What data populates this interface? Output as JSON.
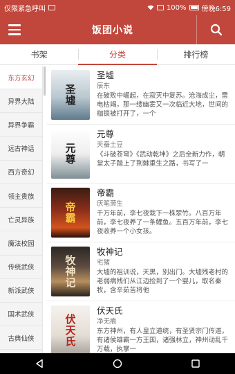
{
  "status_bar": {
    "left_text": "仅限紧急呼叫",
    "battery": "100%",
    "time": "傍晚6:59"
  },
  "app_bar": {
    "title": "饭团小说"
  },
  "tabs": [
    {
      "label": "书架",
      "active": false
    },
    {
      "label": "分类",
      "active": true
    },
    {
      "label": "排行榜",
      "active": false
    }
  ],
  "sidebar": {
    "items": [
      {
        "label": "东方玄幻",
        "active": true
      },
      {
        "label": "异界大陆",
        "active": false
      },
      {
        "label": "异界争霸",
        "active": false
      },
      {
        "label": "远古神话",
        "active": false
      },
      {
        "label": "西方奇幻",
        "active": false
      },
      {
        "label": "领主贵族",
        "active": false
      },
      {
        "label": "亡灵异族",
        "active": false
      },
      {
        "label": "魔法校园",
        "active": false
      },
      {
        "label": "传统武侠",
        "active": false
      },
      {
        "label": "新派武侠",
        "active": false
      },
      {
        "label": "国术武侠",
        "active": false
      },
      {
        "label": "古典仙侠",
        "active": false
      }
    ]
  },
  "books": [
    {
      "title": "圣墟",
      "author": "辰东",
      "desc": "在破败中崛起，在寂灭中复苏。沧海成尘，雷电枯竭，那一缕幽雾又一次临近大地，世间的枷锁被打开了，一个",
      "cover_text": "圣墟"
    },
    {
      "title": "元尊",
      "author": "天蚕土豆",
      "desc": "《斗破苍穹》《武动乾坤》之后全新力作，朝堂太子踏上了荆棘重生之路，书写了一",
      "cover_text": "元尊"
    },
    {
      "title": "帝霸",
      "author": "厌笔萧生",
      "desc": "千万年前，李七夜栽下一株翠竹。八百万年前，李七夜养了一条鲤鱼。五百万年前，李七夜收养一个小女孩。",
      "cover_text": "帝霸"
    },
    {
      "title": "牧神记",
      "author": "宅猪",
      "desc": "大墟的祖训说，天黑，别出门。大墟残老村的老弱病残们从江边捡到了一个婴儿，取名秦牧，含辛茹苦将他",
      "cover_text": "牧神记"
    },
    {
      "title": "伏天氏",
      "author": "净无痕",
      "desc": "东方神州，有人皇立道统，有圣贤宗门传道，有诸侯雄霸一方王国，诸强林立，神州动乱千万载，执掌一",
      "cover_text": "伏天氏"
    }
  ],
  "colors": {
    "brand": "#c1473c",
    "active_text": "#c1473c"
  },
  "icons": {
    "menu": "hamburger-menu-icon",
    "search": "search-icon",
    "back": "back-triangle-icon",
    "home": "home-circle-icon",
    "recents": "recents-square-icon"
  }
}
